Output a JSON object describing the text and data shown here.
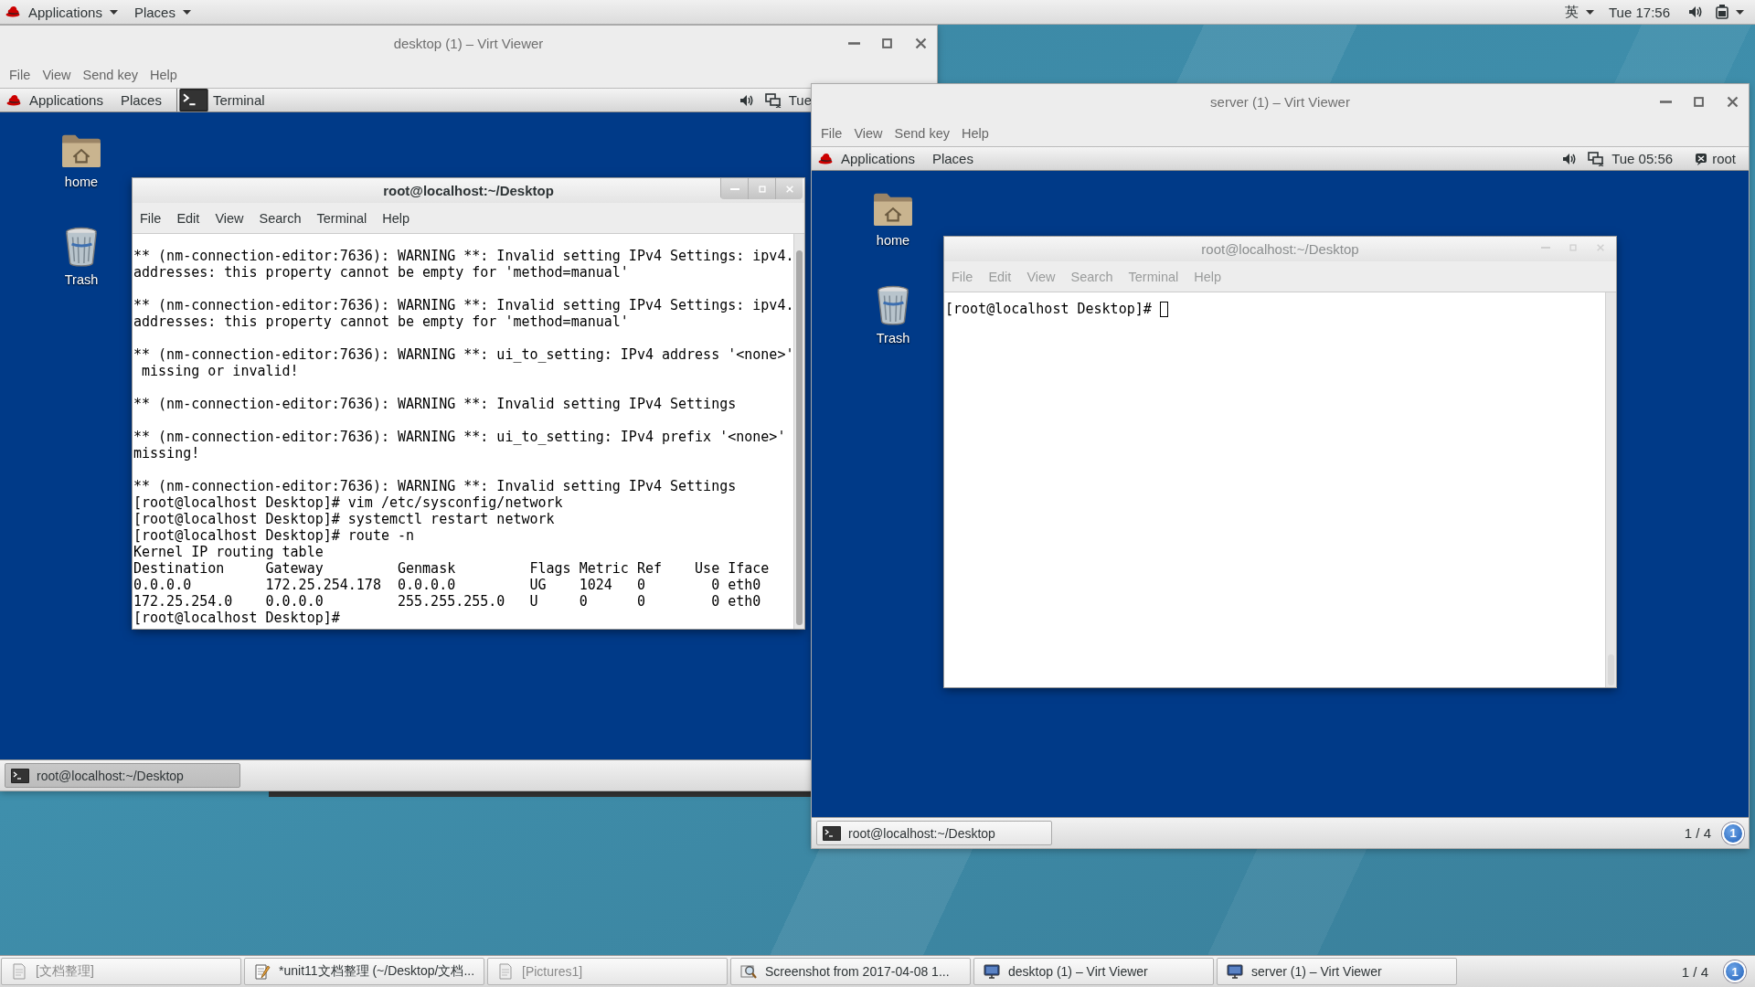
{
  "top_bar": {
    "menus": [
      {
        "label": "Applications"
      },
      {
        "label": "Places"
      }
    ],
    "input_method": "英",
    "clock": "Tue 17:56"
  },
  "windows": [
    {
      "title": "desktop (1) – Virt Viewer",
      "menus": [
        "File",
        "View",
        "Send key",
        "Help"
      ],
      "guest": {
        "panel": {
          "menus": [
            "Applications",
            "Places"
          ],
          "task": "Terminal",
          "clock": "Tue"
        },
        "icons": [
          {
            "kind": "folder",
            "label": "home"
          },
          {
            "kind": "trash",
            "label": "Trash"
          }
        ],
        "terminal": {
          "title": "root@localhost:~/Desktop",
          "focused": true,
          "cursor": false,
          "menus": [
            "File",
            "Edit",
            "View",
            "Search",
            "Terminal",
            "Help"
          ],
          "blocks": [
            [
              "** (nm-connection-editor:7636): WARNING **: Invalid setting IPv4 Settings: ipv4.",
              "addresses: this property cannot be empty for 'method=manual'"
            ],
            [
              "** (nm-connection-editor:7636): WARNING **: Invalid setting IPv4 Settings: ipv4.",
              "addresses: this property cannot be empty for 'method=manual'"
            ],
            [
              "** (nm-connection-editor:7636): WARNING **: ui_to_setting: IPv4 address '<none>'",
              " missing or invalid!"
            ],
            [
              "** (nm-connection-editor:7636): WARNING **: Invalid setting IPv4 Settings"
            ],
            [
              "** (nm-connection-editor:7636): WARNING **: ui_to_setting: IPv4 prefix '<none>'",
              "missing!"
            ],
            [
              "** (nm-connection-editor:7636): WARNING **: Invalid setting IPv4 Settings",
              "[root@localhost Desktop]# vim /etc/sysconfig/network",
              "[root@localhost Desktop]# systemctl restart network",
              "[root@localhost Desktop]# route -n",
              "Kernel IP routing table",
              "Destination     Gateway         Genmask         Flags Metric Ref    Use Iface",
              "0.0.0.0         172.25.254.178  0.0.0.0         UG    1024   0        0 eth0",
              "172.25.254.0    0.0.0.0         255.255.255.0   U     0      0        0 eth0",
              "[root@localhost Desktop]#"
            ]
          ]
        },
        "taskbar": {
          "buttons": [
            {
              "label": "root@localhost:~/Desktop",
              "selected": true
            }
          ]
        }
      }
    },
    {
      "title": "server (1) – Virt Viewer",
      "menus": [
        "File",
        "View",
        "Send key",
        "Help"
      ],
      "guest": {
        "panel": {
          "menus": [
            "Applications",
            "Places"
          ],
          "clock": "Tue 05:56",
          "user": "root"
        },
        "icons": [
          {
            "kind": "folder",
            "label": "home"
          },
          {
            "kind": "trash",
            "label": "Trash"
          }
        ],
        "terminal": {
          "title": "root@localhost:~/Desktop",
          "focused": false,
          "cursor": true,
          "menus": [
            "File",
            "Edit",
            "View",
            "Search",
            "Terminal",
            "Help"
          ],
          "blocks": [
            [
              "[root@localhost Desktop]# "
            ]
          ]
        },
        "taskbar": {
          "buttons": [
            {
              "label": "root@localhost:~/Desktop",
              "selected": false
            }
          ],
          "workspace": "1 / 4",
          "notification": "1"
        }
      }
    }
  ],
  "taskbar": {
    "items": [
      {
        "kind": "document",
        "label": "[文档整理]",
        "minimized": true
      },
      {
        "kind": "editor",
        "label": "*unit11文档整理 (~/Desktop/文档...",
        "minimized": false
      },
      {
        "kind": "document",
        "label": "[Pictures1]",
        "minimized": true
      },
      {
        "kind": "screenshot",
        "label": "Screenshot from 2017-04-08 1...",
        "minimized": false
      },
      {
        "kind": "monitor",
        "label": "desktop (1) – Virt Viewer",
        "minimized": false
      },
      {
        "kind": "monitor",
        "label": "server (1) – Virt Viewer",
        "minimized": false
      }
    ],
    "workspace": "1 / 4",
    "notification": "1"
  }
}
